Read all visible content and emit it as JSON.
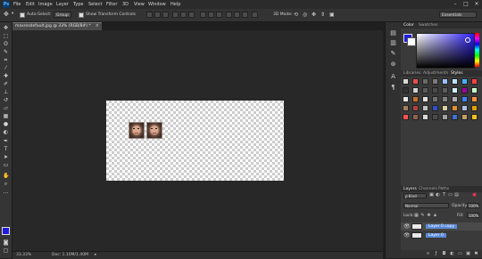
{
  "menu": {
    "logo": "Ps",
    "items": [
      "File",
      "Edit",
      "Image",
      "Layer",
      "Type",
      "Select",
      "Filter",
      "3D",
      "View",
      "Window",
      "Help"
    ]
  },
  "window_controls": [
    "–",
    "□",
    "✕"
  ],
  "options": {
    "auto_select_label": "Auto-Select:",
    "auto_select_value": "Group",
    "show_transform_label": "Show Transform Controls",
    "mode_3d_label": "3D Mode:",
    "workspace": "Essentials"
  },
  "document": {
    "tab_title": "maxresdefault.jpg @ 33% (RGB/8#) *",
    "close": "×"
  },
  "status": {
    "zoom": "33.33%",
    "doc_size": "Doc: 1.10M/1.40M"
  },
  "color_panel": {
    "tabs": [
      "Color",
      "Swatches"
    ],
    "active_tab": "Color",
    "foreground": "#1f1ae0",
    "background": "#ffffff"
  },
  "styles_panel": {
    "tabs": [
      "Libraries",
      "Adjustments",
      "Styles"
    ],
    "active_tab": "Styles",
    "swatches": [
      "#d9d9d9",
      "#e85050",
      "#6a6a6a",
      "#7a7a7a",
      "#9ac0ff",
      "#c0e0ff",
      "#48b0ff",
      "#ff4040",
      "#333333",
      "#d0d0d0",
      "#5a5a5a",
      "#4a4a4a",
      "#5c5c5c",
      "#d0f0ff",
      "#a000a0",
      "#c8ffc8",
      "#e8e8e8",
      "#c07030",
      "#e0e0e0",
      "#707070",
      "#808080",
      "#b0b0b0",
      "#4080ff",
      "#ff9040",
      "#a08060",
      "#b04040",
      "#c0c0c0",
      "#3050c0",
      "#d0d0a0",
      "#e09030",
      "#b0c0e0",
      "#e0a000",
      "#ff5050",
      "#906050",
      "#d8d8d8",
      "#4a4a4a",
      "#a0a0a0",
      "#4070d0",
      "#c0a060",
      "#f0c020"
    ]
  },
  "layers_panel": {
    "tabs": [
      "Layers",
      "Channels",
      "Paths"
    ],
    "active_tab": "Layers",
    "kind_filter": "ρ Kind",
    "blend_mode": "Normal",
    "opacity_label": "Opacity:",
    "opacity_value": "100%",
    "lock_label": "Lock:",
    "fill_label": "Fill:",
    "fill_value": "100%",
    "layers": [
      {
        "name": "Layer 0 copy",
        "visible": true
      },
      {
        "name": "Layer 0",
        "visible": true
      }
    ],
    "footer_icons": [
      "link-icon",
      "fx-icon",
      "mask-icon",
      "adjustment-icon",
      "folder-icon",
      "new-layer-icon",
      "trash-icon"
    ]
  },
  "canvas": {
    "faces": 2
  }
}
